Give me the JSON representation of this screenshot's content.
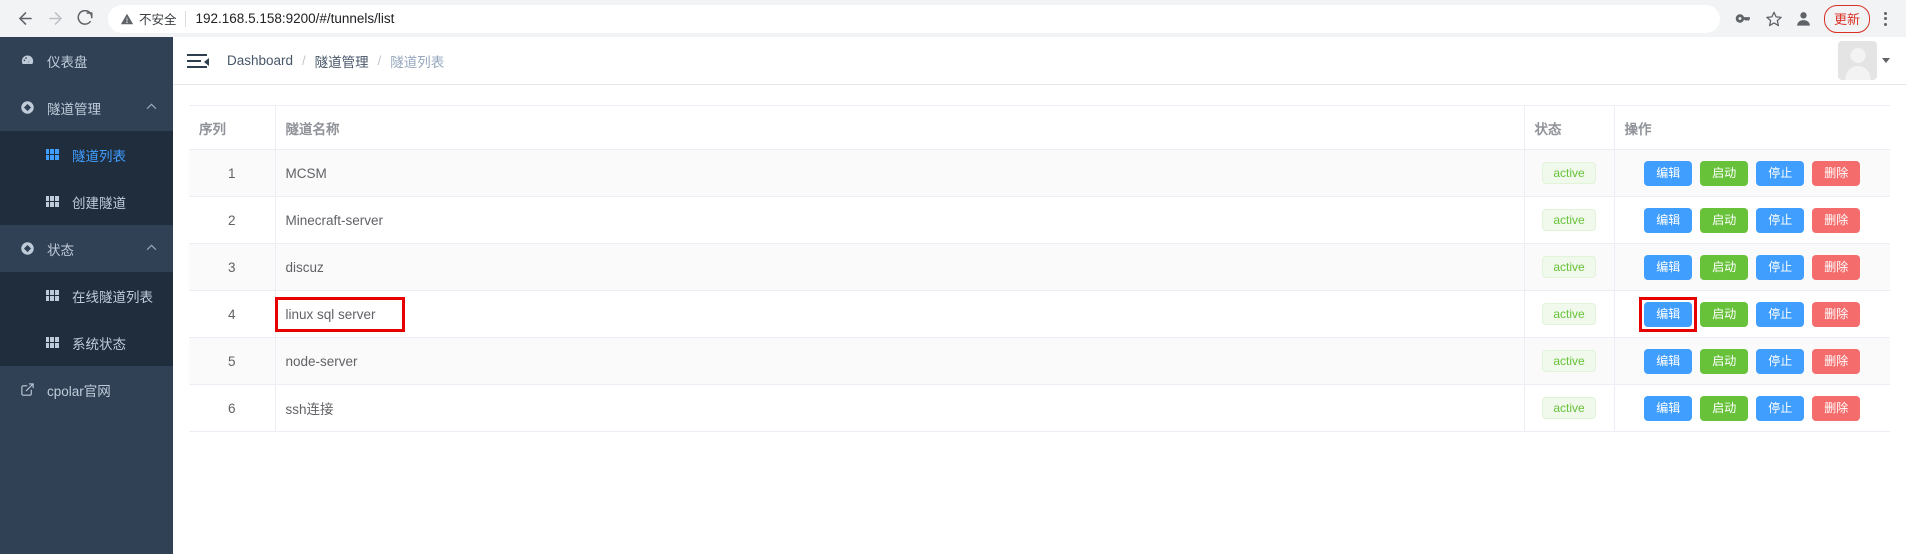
{
  "browser": {
    "back_icon": "back-arrow-icon",
    "forward_icon": "forward-arrow-icon",
    "reload_icon": "reload-icon",
    "security_warning_icon": "warning-triangle-icon",
    "security_label": "不安全",
    "url": "192.168.5.158:9200/#/tunnels/list",
    "url_host": "192.168.5.158:9200",
    "url_path": "/#/tunnels/list",
    "key_icon": "key-icon",
    "bookmark_icon": "star-icon",
    "profile_icon": "profile-avatar-icon",
    "update_label": "更新",
    "menu_icon": "kebab-menu-icon"
  },
  "sidebar": {
    "items": [
      {
        "label": "仪表盘",
        "icon": "dashboard-icon",
        "type": "item"
      },
      {
        "label": "隧道管理",
        "icon": "tunnel-icon",
        "type": "group",
        "arrow": "chevron-up-icon"
      },
      {
        "label": "隧道列表",
        "icon": "grid-icon",
        "type": "sub",
        "active": true
      },
      {
        "label": "创建隧道",
        "icon": "grid-icon",
        "type": "sub",
        "active": false
      },
      {
        "label": "状态",
        "icon": "status-icon",
        "type": "group",
        "arrow": "chevron-up-icon"
      },
      {
        "label": "在线隧道列表",
        "icon": "grid-icon",
        "type": "sub",
        "active": false
      },
      {
        "label": "系统状态",
        "icon": "grid-icon",
        "type": "sub",
        "active": false
      },
      {
        "label": "cpolar官网",
        "icon": "external-link-icon",
        "type": "item"
      }
    ]
  },
  "navbar": {
    "hamburger_icon": "collapse-sidebar-icon",
    "breadcrumb": [
      {
        "label": "Dashboard",
        "active": false
      },
      {
        "label": "隧道管理",
        "active": false
      },
      {
        "label": "隧道列表",
        "active": true
      }
    ],
    "separator": "/",
    "avatar_icon": "user-avatar-icon",
    "caret_icon": "chevron-down-icon"
  },
  "table": {
    "columns": [
      "序列",
      "隧道名称",
      "状态",
      "操作"
    ],
    "actions": {
      "edit": "编辑",
      "start": "启动",
      "stop": "停止",
      "delete": "删除"
    },
    "rows": [
      {
        "seq": "1",
        "name": "MCSM",
        "status": "active"
      },
      {
        "seq": "2",
        "name": "Minecraft-server",
        "status": "active"
      },
      {
        "seq": "3",
        "name": "discuz",
        "status": "active"
      },
      {
        "seq": "4",
        "name": "linux sql server",
        "status": "active"
      },
      {
        "seq": "5",
        "name": "node-server",
        "status": "active"
      },
      {
        "seq": "6",
        "name": "ssh连接",
        "status": "active"
      }
    ]
  },
  "annotations": {
    "color": "#e60000",
    "boxes": [
      {
        "target": "row-4-tunnel-name"
      },
      {
        "target": "row-4-edit-button"
      }
    ]
  }
}
